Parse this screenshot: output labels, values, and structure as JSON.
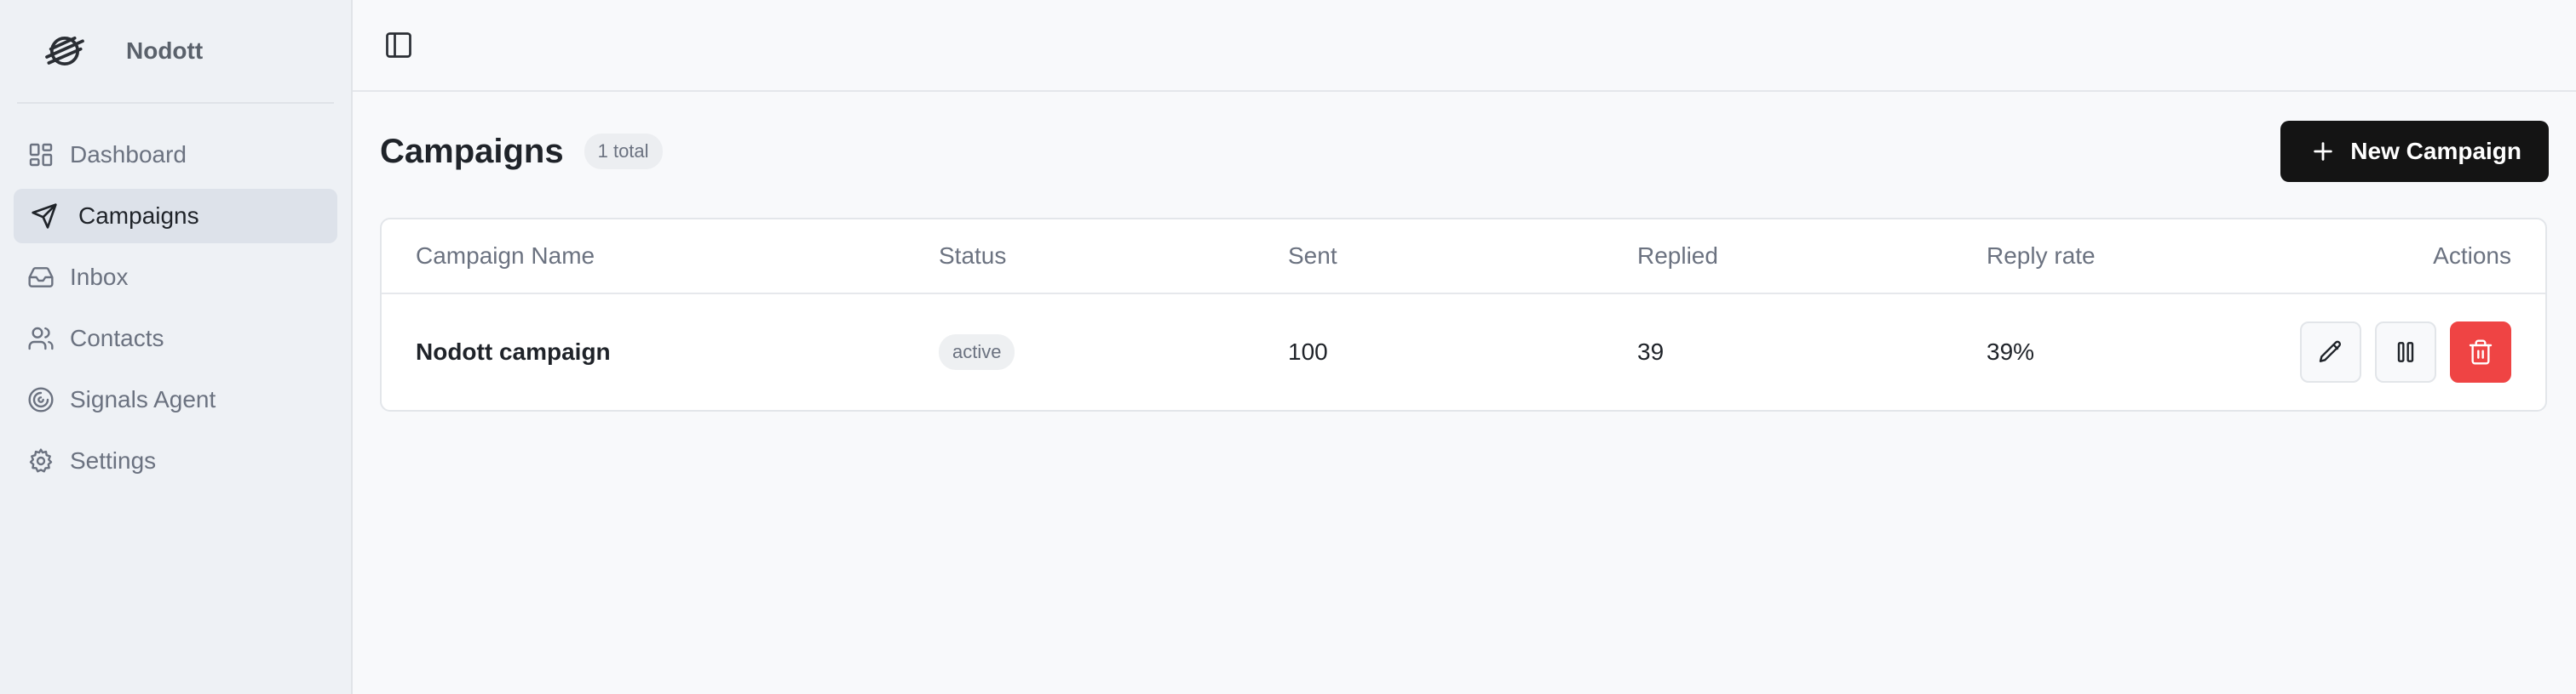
{
  "brand": {
    "name": "Nodott"
  },
  "sidebar": {
    "items": [
      {
        "label": "Dashboard",
        "icon": "dashboard-icon"
      },
      {
        "label": "Campaigns",
        "icon": "send-icon",
        "active": true
      },
      {
        "label": "Inbox",
        "icon": "inbox-icon"
      },
      {
        "label": "Contacts",
        "icon": "users-icon"
      },
      {
        "label": "Signals Agent",
        "icon": "signal-icon"
      },
      {
        "label": "Settings",
        "icon": "gear-icon"
      }
    ]
  },
  "header": {
    "title": "Campaigns",
    "count": "1 total",
    "new_button": "New Campaign"
  },
  "table": {
    "columns": [
      "Campaign Name",
      "Status",
      "Sent",
      "Replied",
      "Reply rate",
      "Actions"
    ],
    "rows": [
      {
        "name": "Nodott campaign",
        "status": "active",
        "sent": "100",
        "replied": "39",
        "rate": "39%"
      }
    ]
  },
  "colors": {
    "accent": "#141414",
    "danger": "#ef4444",
    "sidebar_bg": "#eef1f5"
  }
}
